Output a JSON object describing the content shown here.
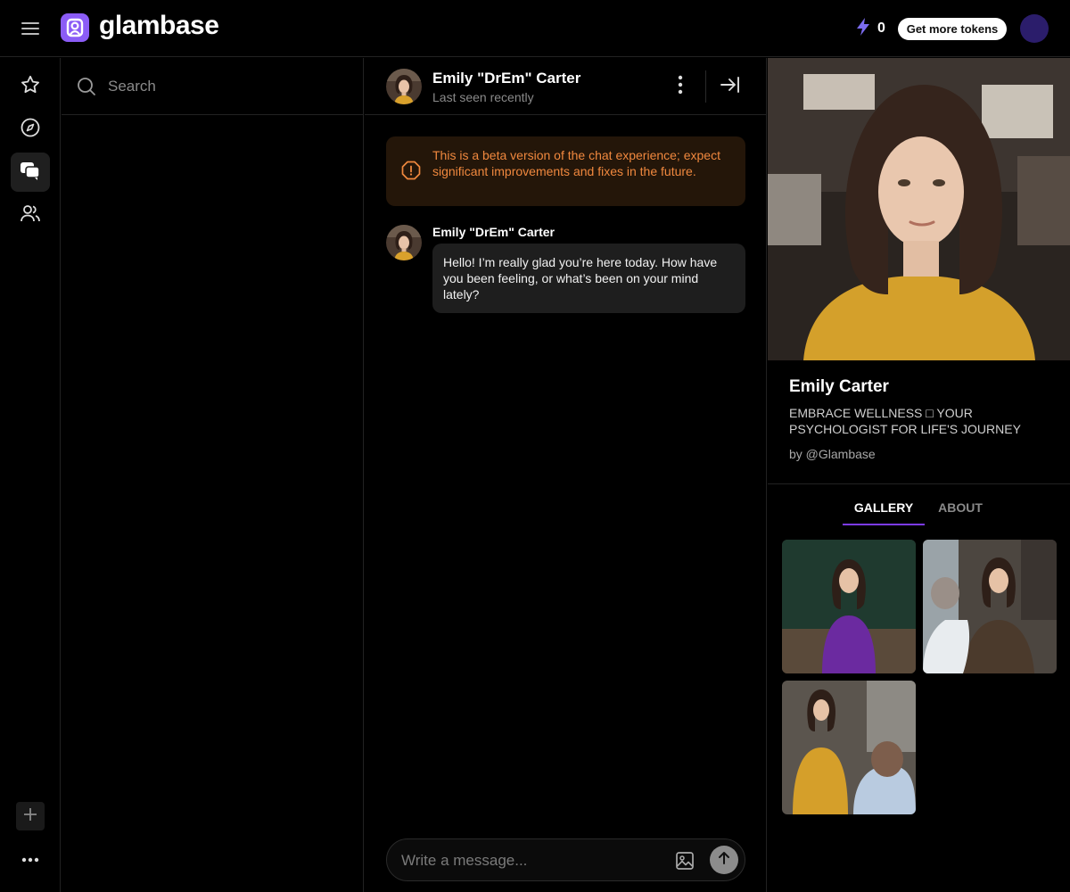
{
  "app": {
    "name": "glambase"
  },
  "topbar": {
    "token_count": "0",
    "get_tokens_label": "Get more tokens"
  },
  "search": {
    "placeholder": "Search"
  },
  "chat": {
    "character_name": "Emily \"DrEm\" Carter",
    "status": "Last seen recently",
    "beta_notice": "This is a beta version of the chat experience; expect significant improvements and fixes in the future.",
    "messages": [
      {
        "author": "Emily \"DrEm\" Carter",
        "text": "Hello! I’m really glad you’re here today. How have you been feeling, or what’s been on your mind lately?"
      }
    ],
    "composer_placeholder": "Write a message..."
  },
  "profile": {
    "name": "Emily Carter",
    "tagline": "EMBRACE WELLNESS □ YOUR PSYCHOLOGIST FOR LIFE'S JOURNEY",
    "author": "by @Glambase",
    "tabs": [
      "GALLERY",
      "ABOUT"
    ],
    "active_tab": "GALLERY"
  },
  "colors": {
    "accent": "#8b5cf6",
    "tab_underline": "#7c3aed",
    "beta_text": "#f0883e",
    "beta_bg": "#241609",
    "bubble_bg": "#1e1e1e"
  },
  "icons": {
    "rail": [
      "star-icon",
      "compass-icon",
      "chat-bubbles-icon",
      "users-icon"
    ],
    "rail_bottom": [
      "plus-icon",
      "more-dots-icon"
    ]
  }
}
